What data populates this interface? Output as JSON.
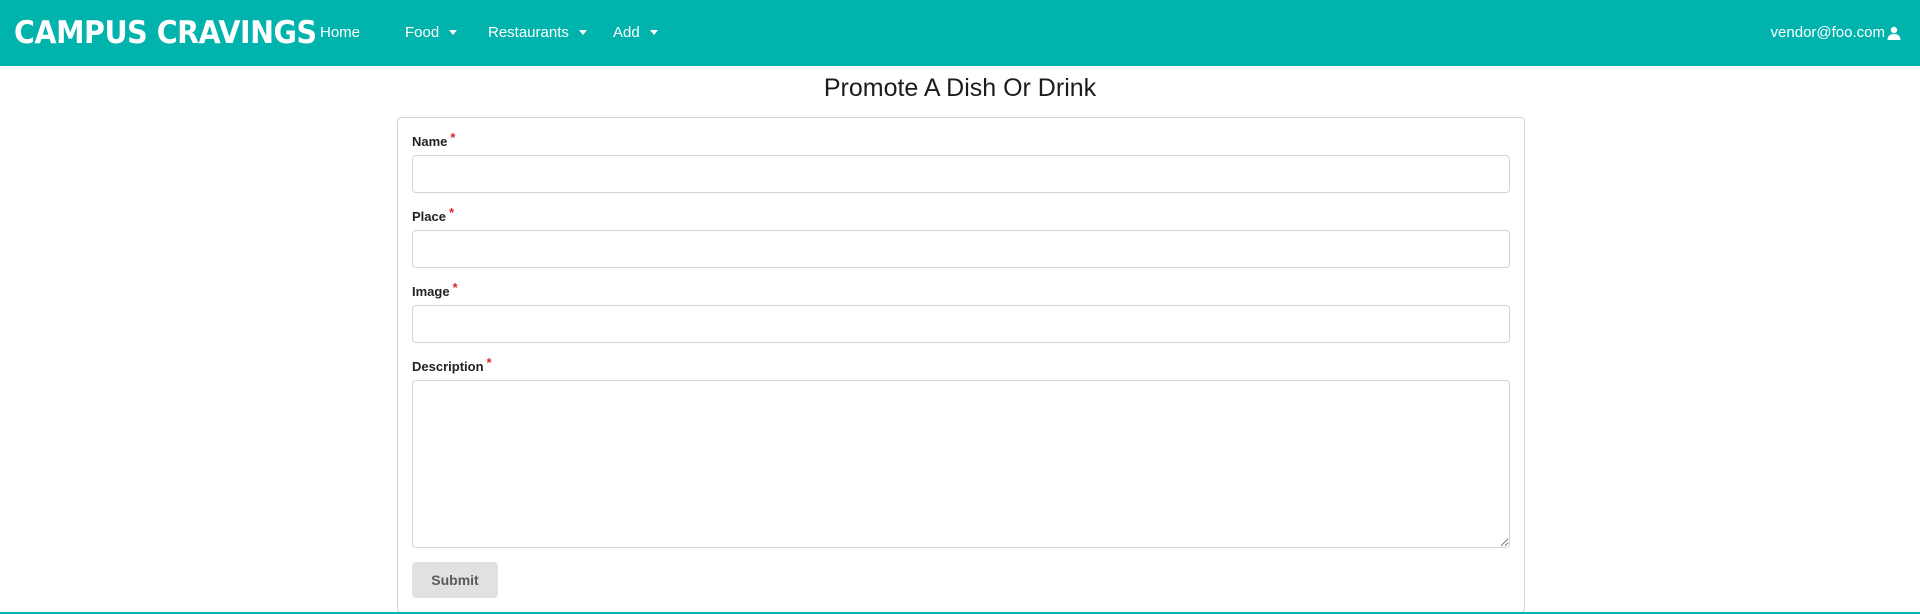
{
  "colors": {
    "accent": "#00b3ac",
    "required": "#db2828",
    "button_bg": "#e0e1e2"
  },
  "navbar": {
    "brand": "CAMPUS CRAVINGS",
    "items": [
      {
        "label": "Home",
        "has_dropdown": false
      },
      {
        "label": "Food",
        "has_dropdown": true
      },
      {
        "label": "Restaurants",
        "has_dropdown": true
      },
      {
        "label": "Add",
        "has_dropdown": true
      }
    ],
    "user": {
      "email": "vendor@foo.com",
      "icon": "user-icon"
    }
  },
  "page": {
    "title": "Promote A Dish Or Drink"
  },
  "form": {
    "fields": [
      {
        "label": "Name",
        "required_mark": "*",
        "value": ""
      },
      {
        "label": "Place",
        "required_mark": "*",
        "value": ""
      },
      {
        "label": "Image",
        "required_mark": "*",
        "value": ""
      },
      {
        "label": "Description",
        "required_mark": "*",
        "value": ""
      }
    ],
    "submit_label": "Submit"
  }
}
